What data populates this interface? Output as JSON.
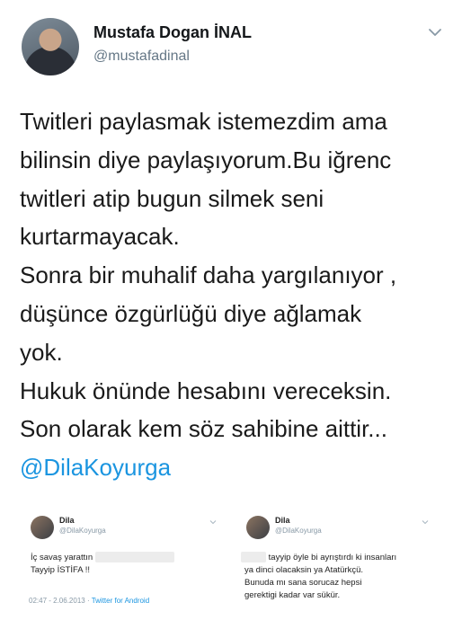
{
  "tweet": {
    "display_name": "Mustafa Dogan İNAL",
    "handle": "@mustafadinal",
    "lines": [
      "Twitleri paylasmak istemezdim ama",
      "bilinsin diye paylaşıyorum.Bu iğrenc",
      "twitleri atip bugun silmek seni",
      "kurtarmayacak.",
      "Sonra bir muhalif daha yargılanıyor ,",
      "düşünce özgürlüğü diye ağlamak",
      "yok.",
      "Hukuk önünde hesabını vereceksin.",
      "Son olarak kem söz sahibine aittir..."
    ],
    "mention": "@DilaKoyurga"
  },
  "embedded_left": {
    "name": "Dila",
    "handle": "@DilaKoyurga",
    "text_line1": "İç savaş yarattın",
    "text_line2": "Tayyip İSTİFA !!",
    "time": "02:47 - 2.06.2013 ·",
    "source": "Twitter for Android"
  },
  "embedded_right": {
    "name": "Dila",
    "handle": "@DilaKoyurga",
    "line1": "tayyip öyle bi ayrıştırdı ki insanları",
    "line2": "ya dinci olacaksin ya Atatürkçü.",
    "line3": "Bunuda mı sana sorucaz hepsi",
    "line4": "gerektigi kadar var sükür."
  },
  "colors": {
    "link": "#1b95e0",
    "text": "#14171a",
    "muted": "#657786"
  },
  "icons": [
    "chevron-down-icon"
  ]
}
